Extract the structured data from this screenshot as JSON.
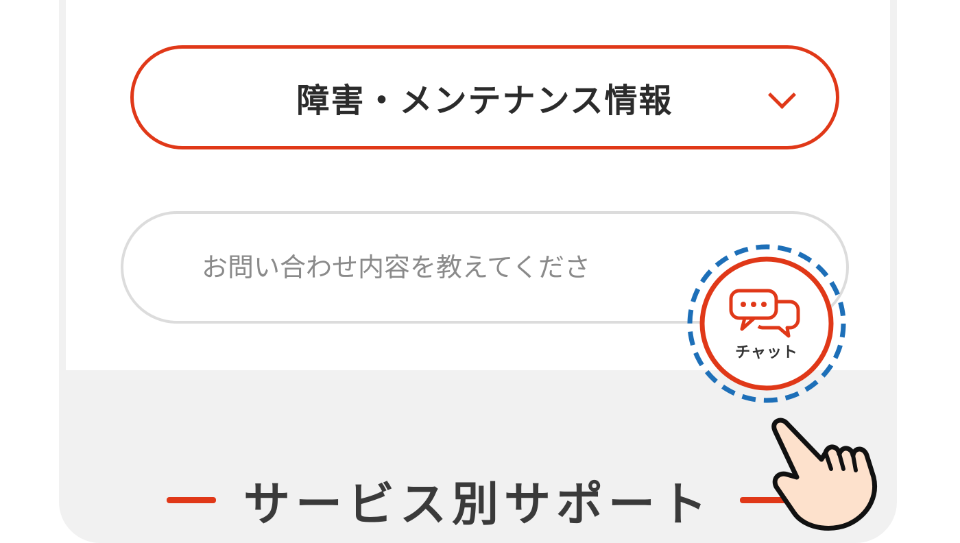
{
  "accordion": {
    "label": "障害・メンテナンス情報"
  },
  "search": {
    "placeholder": "お問い合わせ内容を教えてくださ"
  },
  "chat": {
    "label": "チャット"
  },
  "section": {
    "title": "サービス別サポート"
  },
  "colors": {
    "accent": "#e03818",
    "highlight": "#1d6fb8"
  },
  "icons": [
    "chevron-down-icon",
    "chat-bubble-icon",
    "pointer-hand-icon"
  ]
}
